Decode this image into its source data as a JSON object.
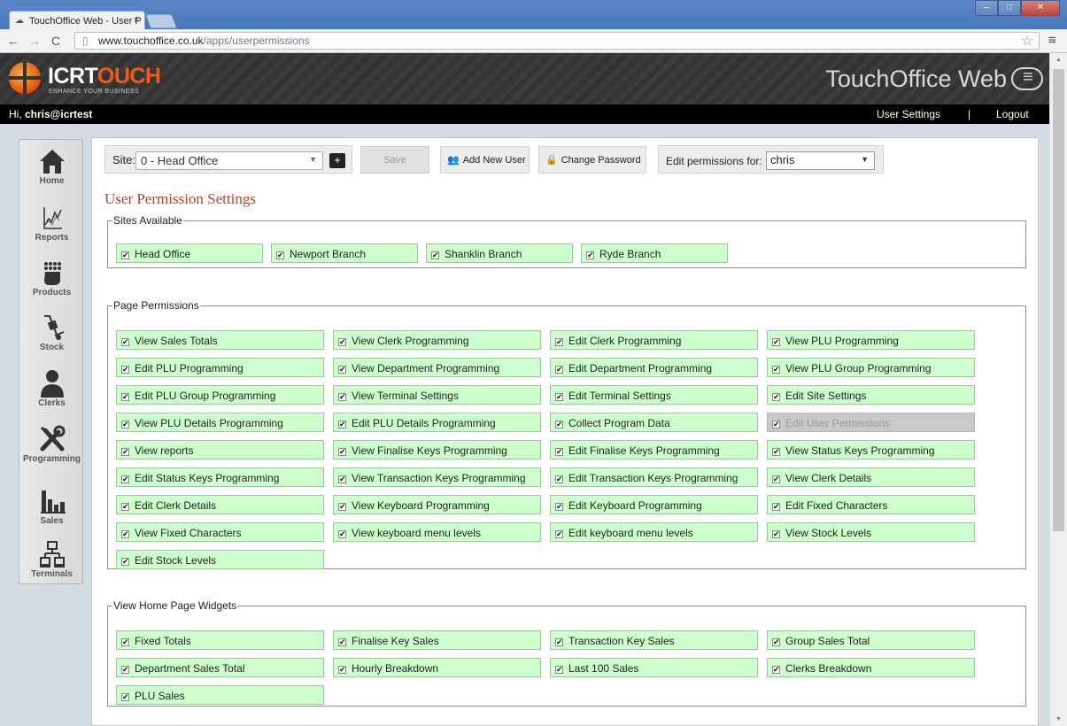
{
  "browser": {
    "tab_title": "TouchOffice Web - User P",
    "tab_close": "×",
    "url_host": "www.touchoffice.co.uk",
    "url_path": "/apps/userpermissions"
  },
  "header": {
    "brand_part1": "ICRT",
    "brand_part2": "O",
    "brand_part3": "UCH",
    "tagline": "ENHANCE YOUR BUSINESS",
    "product": "TouchOffice Web"
  },
  "userbar": {
    "greeting": "Hi, ",
    "user": "chris@icrtest",
    "settings": "User Settings",
    "separator": "|",
    "logout": "Logout"
  },
  "sidebar": [
    {
      "label": "Home",
      "icon": "home-icon"
    },
    {
      "label": "Reports",
      "icon": "reports-icon"
    },
    {
      "label": "Products",
      "icon": "products-icon"
    },
    {
      "label": "Stock",
      "icon": "stock-icon"
    },
    {
      "label": "Clerks",
      "icon": "clerks-icon"
    },
    {
      "label": "Programming",
      "icon": "programming-icon"
    },
    {
      "label": "Sales",
      "icon": "sales-icon"
    },
    {
      "label": "Terminals",
      "icon": "terminals-icon"
    }
  ],
  "toolbar": {
    "site_label": "Site:",
    "site_value": "0 - Head Office",
    "plus": "+",
    "save": "Save",
    "add_user": "Add New User",
    "change_password": "Change Password",
    "edit_for_label": "Edit permissions for:",
    "edit_for_value": "chris"
  },
  "page_title": "User Permission Settings",
  "sites": {
    "legend": "Sites Available",
    "items": [
      "Head Office",
      "Newport Branch",
      "Shanklin Branch",
      "Ryde Branch"
    ]
  },
  "page_permissions": {
    "legend": "Page Permissions",
    "items": [
      "View Sales Totals",
      "View Clerk Programming",
      "Edit Clerk Programming",
      "View PLU Programming",
      "Edit PLU Programming",
      "View Department Programming",
      "Edit Department Programming",
      "View PLU Group Programming",
      "Edit PLU Group Programming",
      "View Terminal Settings",
      "Edit Terminal Settings",
      "Edit Site Settings",
      "View PLU Details Programming",
      "Edit PLU Details Programming",
      "Collect Program Data",
      "Edit User Permissions",
      "View reports",
      "View Finalise Keys Programming",
      "Edit Finalise Keys Programming",
      "View Status Keys Programming",
      "Edit Status Keys Programming",
      "View Transaction Keys Programming",
      "Edit Transaction Keys Programming",
      "View Clerk Details",
      "Edit Clerk Details",
      "View Keyboard Programming",
      "Edit Keyboard Programming",
      "Edit Fixed Characters",
      "View Fixed Characters",
      "View keyboard menu levels",
      "Edit keyboard menu levels",
      "View Stock Levels",
      "Edit Stock Levels"
    ],
    "disabled_item": "Edit User Permissions"
  },
  "widgets": {
    "legend": "View Home Page Widgets",
    "items": [
      "Fixed Totals",
      "Finalise Key Sales",
      "Transaction Key Sales",
      "Group Sales Total",
      "Department Sales Total",
      "Hourly Breakdown",
      "Last 100 Sales",
      "Clerks Breakdown",
      "PLU Sales"
    ]
  },
  "check_glyph": "✔",
  "colors": {
    "accent_title": "#b5432a",
    "checked_bg": "#ccffcc",
    "brand_orange": "#f05a14"
  }
}
